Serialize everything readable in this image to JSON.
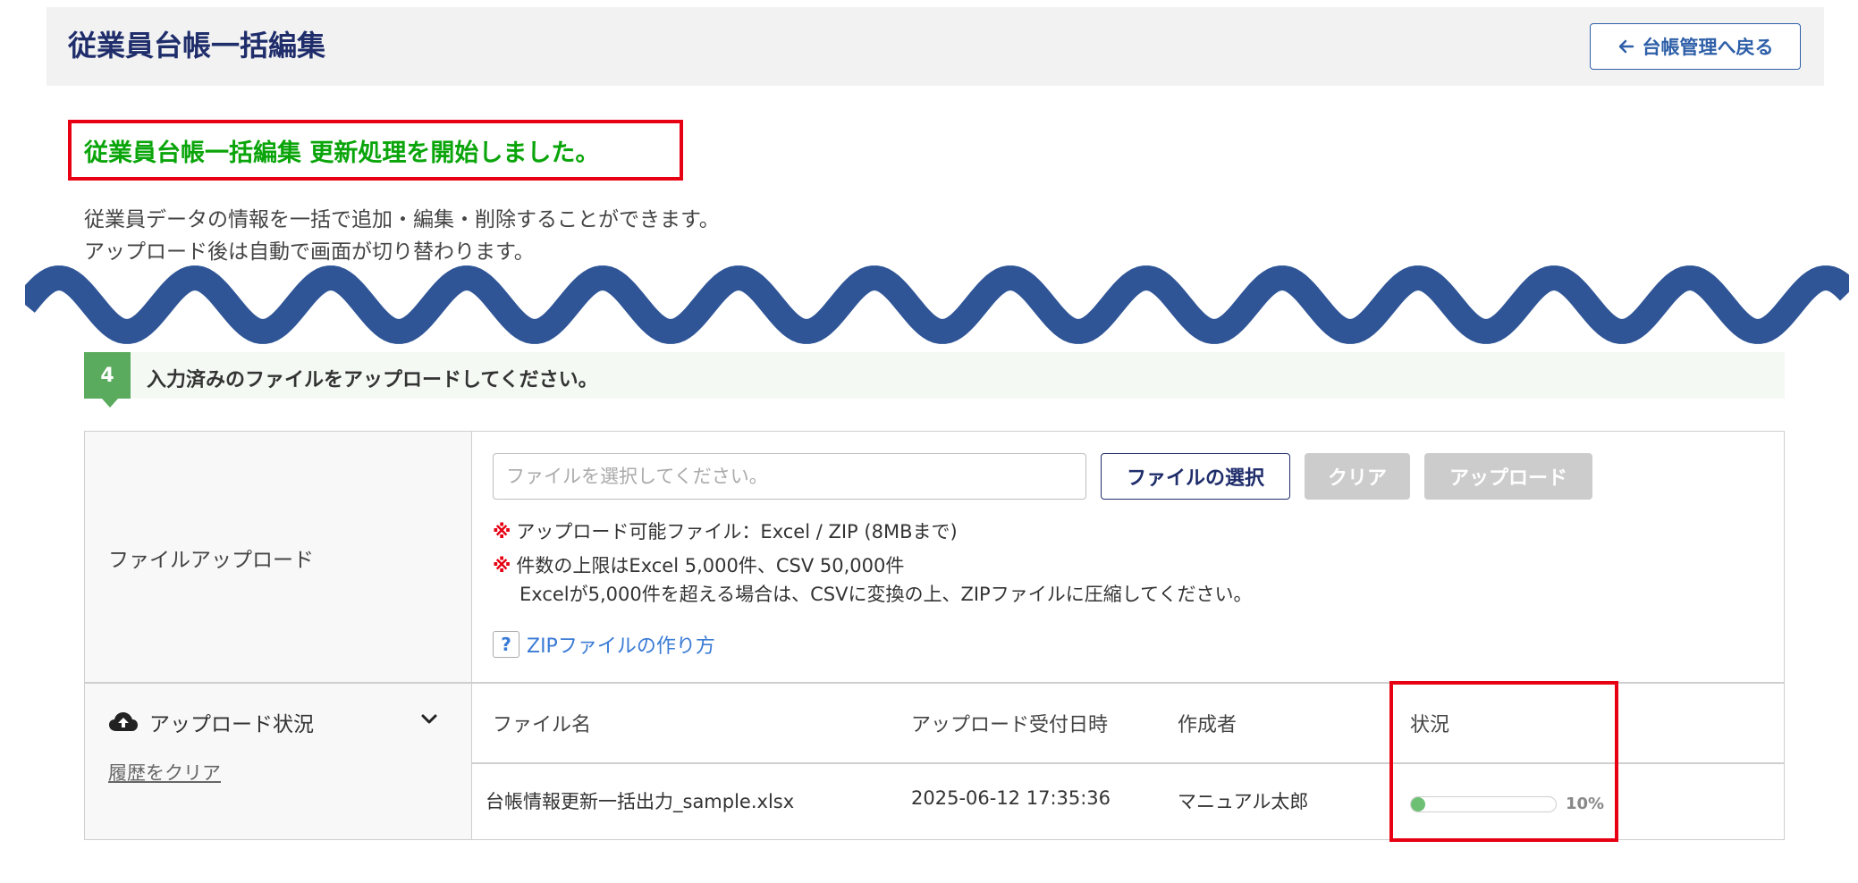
{
  "header": {
    "title": "従業員台帳一括編集",
    "back_button_label": "台帳管理へ戻る"
  },
  "message": {
    "success": "従業員台帳一括編集 更新処理を開始しました。"
  },
  "description": {
    "line1": "従業員データの情報を一括で追加・編集・削除することができます。",
    "line2": "アップロード後は自動で画面が切り替わります。"
  },
  "step": {
    "number": "4",
    "text": "入力済みのファイルをアップロードしてください。"
  },
  "upload": {
    "label": "ファイルアップロード",
    "file_input_placeholder": "ファイルを選択してください。",
    "select_button": "ファイルの選択",
    "clear_button": "クリア",
    "upload_button": "アップロード",
    "note_mark": "※",
    "note1": "アップロード可能ファイル：Excel / ZIP (8MBまで)",
    "note2_line1": "件数の上限はExcel 5,000件、CSV 50,000件",
    "note2_line2": "Excelが5,000件を超える場合は、CSVに変換の上、ZIPファイルに圧縮してください。",
    "help_icon_text": "?",
    "help_link": "ZIPファイルの作り方"
  },
  "status": {
    "heading": "アップロード状況",
    "clear_history": "履歴をクリア",
    "columns": [
      "ファイル名",
      "アップロード受付日時",
      "作成者",
      "状況"
    ],
    "rows": [
      {
        "file_name": "台帳情報更新一括出力_sample.xlsx",
        "received_at": "2025-06-12 17:35:36",
        "author": "マニュアル太郎",
        "progress_percent": 10,
        "progress_label": "10%"
      }
    ]
  },
  "colors": {
    "title_navy": "#1f2d6b",
    "link_blue": "#2e5fa8",
    "success_green": "#0aa50a",
    "highlight_red": "#e60012",
    "wave_blue": "#2f5597",
    "step_green": "#5aab5e"
  },
  "icons": {
    "back": "arrow-left-icon",
    "cloud": "cloud-upload-icon",
    "chevron": "chevron-down-icon",
    "help": "question-icon"
  }
}
